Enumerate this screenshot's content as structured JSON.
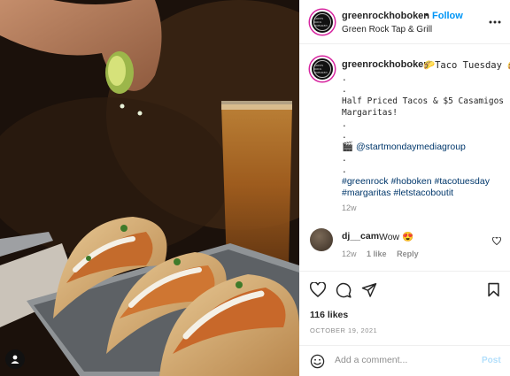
{
  "post": {
    "username": "greenrockhoboken",
    "follow_label": "Follow",
    "location": "Green Rock Tap & Grill",
    "avatar_text": "GREEN ROCK HOBOKEN"
  },
  "caption": {
    "username": "greenrockhoboken",
    "title": "🌮Taco Tuesday 🌮",
    "line_dot1": ".",
    "line_dot2": ".",
    "offer": "Half Priced Tacos & $5 Casamigos Margaritas!",
    "line_dot3": ".",
    "line_dot4": ".",
    "credit_emoji": "🎬",
    "credit": "@startmondaymediagroup",
    "line_dot5": ".",
    "line_dot6": ".",
    "hashtags_line1": "#greenrock #hoboken #tacotuesday",
    "hashtags_line2": "#margaritas #letstacoboutit",
    "time": "12w"
  },
  "comment": {
    "username": "dj__cam",
    "text": "Wow 😍",
    "time": "12w",
    "likes": "1 like",
    "reply_label": "Reply"
  },
  "actions": {
    "likes": "116 likes",
    "date": "OCTOBER 19, 2021"
  },
  "add_comment": {
    "placeholder": "Add a comment...",
    "post_label": "Post"
  },
  "colors": {
    "accent": "#0095f6",
    "link": "#00376b",
    "muted": "#8e8e8e"
  },
  "icons": [
    "more-icon",
    "heart-icon",
    "comment-icon",
    "share-icon",
    "bookmark-icon",
    "emoji-icon",
    "user-tag-icon"
  ]
}
